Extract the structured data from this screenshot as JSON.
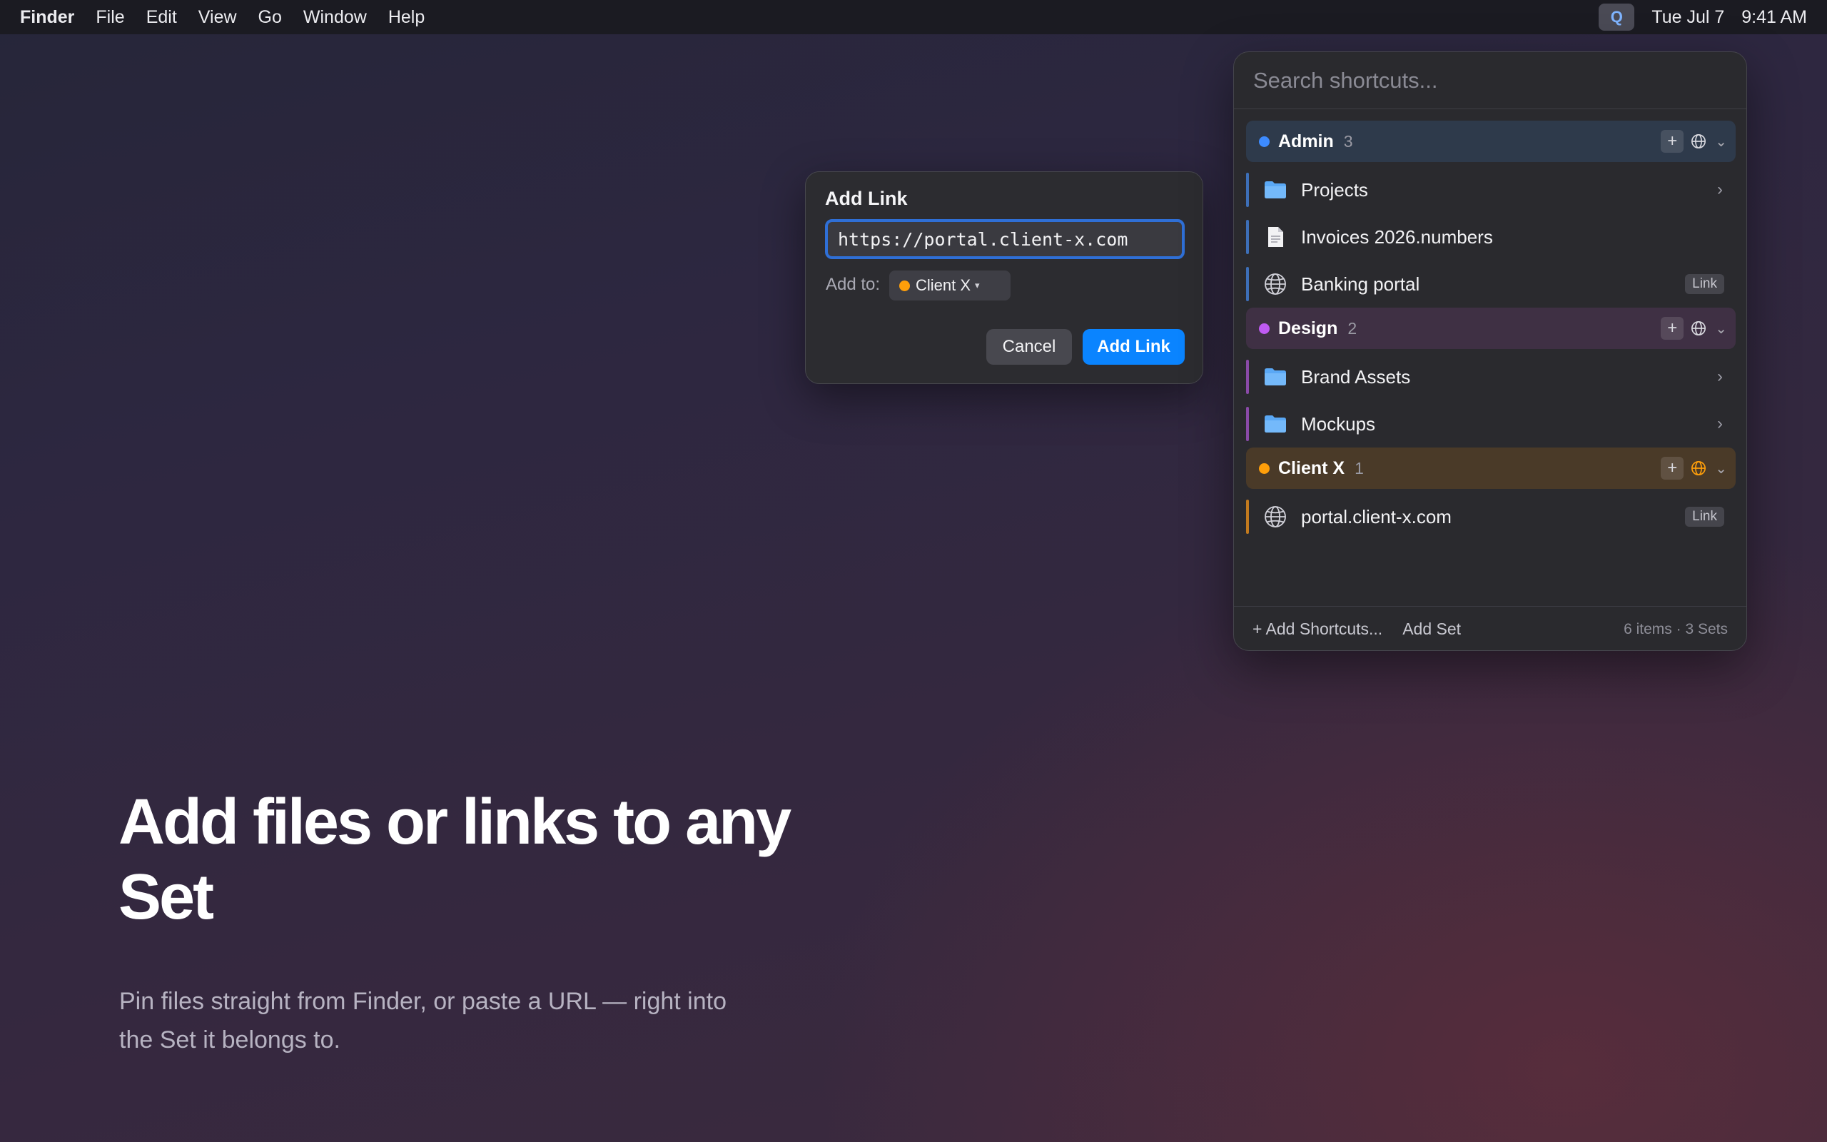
{
  "menubar": {
    "app_name": "Finder",
    "menus": [
      "File",
      "Edit",
      "View",
      "Go",
      "Window",
      "Help"
    ],
    "status_icon": "Q",
    "date": "Tue Jul 7",
    "time": "9:41 AM"
  },
  "hero": {
    "title": "Add files or links to any Set",
    "subtitle": "Pin files straight from Finder, or paste a URL — right into the Set it belongs to."
  },
  "dialog": {
    "title": "Add Link",
    "url_value": "https://portal.client-x.com",
    "add_to_label": "Add to:",
    "selected_set": "Client X",
    "selected_set_color": "#ff9f0a",
    "cancel_label": "Cancel",
    "confirm_label": "Add Link"
  },
  "panel": {
    "search_placeholder": "Search shortcuts...",
    "groups": [
      {
        "name": "Admin",
        "count": "3",
        "color": "#3d8bff",
        "items": [
          {
            "label": "Projects",
            "icon": "folder-icon",
            "accessory": "chevron"
          },
          {
            "label": "Invoices 2026.numbers",
            "icon": "document-icon",
            "accessory": ""
          },
          {
            "label": "Banking portal",
            "icon": "globe-icon",
            "accessory": "Link"
          }
        ]
      },
      {
        "name": "Design",
        "count": "2",
        "color": "#bf5af2",
        "items": [
          {
            "label": "Brand Assets",
            "icon": "folder-icon",
            "accessory": "chevron"
          },
          {
            "label": "Mockups",
            "icon": "folder-icon",
            "accessory": "chevron"
          }
        ]
      },
      {
        "name": "Client X",
        "count": "1",
        "color": "#ff9f0a",
        "items": [
          {
            "label": "portal.client-x.com",
            "icon": "globe-icon",
            "accessory": "Link"
          }
        ]
      }
    ],
    "footer": {
      "add_shortcuts": "+ Add Shortcuts...",
      "add_set": "Add Set",
      "summary": "6 items · 3 Sets"
    }
  }
}
